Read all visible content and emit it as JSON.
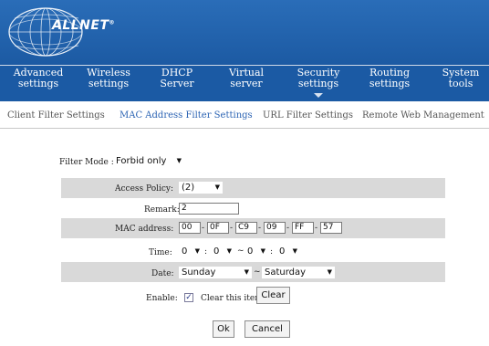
{
  "brand": {
    "logo_text": "ALLNET",
    "trademark": "®"
  },
  "nav": [
    {
      "line1": "Advanced",
      "line2": "settings"
    },
    {
      "line1": "Wireless",
      "line2": "settings"
    },
    {
      "line1": "DHCP",
      "line2": "Server"
    },
    {
      "line1": "Virtual",
      "line2": "server"
    },
    {
      "line1": "Security",
      "line2": "settings"
    },
    {
      "line1": "Routing",
      "line2": "settings"
    },
    {
      "line1": "System",
      "line2": "tools"
    }
  ],
  "subnav": [
    "Client Filter Settings",
    "MAC Address Filter Settings",
    "URL Filter Settings",
    "Remote Web Management"
  ],
  "form": {
    "filter_mode": {
      "label": "Filter Mode :",
      "value": "Forbid only"
    },
    "access_policy": {
      "label": "Access Policy:",
      "value": "(2)"
    },
    "remark": {
      "label": "Remark:",
      "value": "2"
    },
    "mac_address": {
      "label": "MAC address:",
      "octets": [
        "00",
        "0F",
        "C9",
        "09",
        "FF",
        "57"
      ],
      "separator": "-"
    },
    "time": {
      "label": "Time:",
      "start_hour": "0",
      "start_min": "0",
      "end_hour": "0",
      "end_min": "0",
      "colon": ":",
      "range_sep": "~"
    },
    "date": {
      "label": "Date:",
      "start_day": "Sunday",
      "end_day": "Saturday",
      "range_sep": "~"
    },
    "enable": {
      "label": "Enable:",
      "checked": true,
      "check_mark": "✓",
      "clear_label": "Clear this item:",
      "clear_button": "Clear"
    }
  },
  "buttons": {
    "ok": "Ok",
    "cancel": "Cancel"
  },
  "colors": {
    "header_blue": "#1f5ea6",
    "active_link": "#2b63b3",
    "row_band": "#d9d9d9"
  },
  "icons": {
    "logo": "globe-logo-icon",
    "dropdown": "chevron-down-icon",
    "checkbox": "check-icon"
  }
}
